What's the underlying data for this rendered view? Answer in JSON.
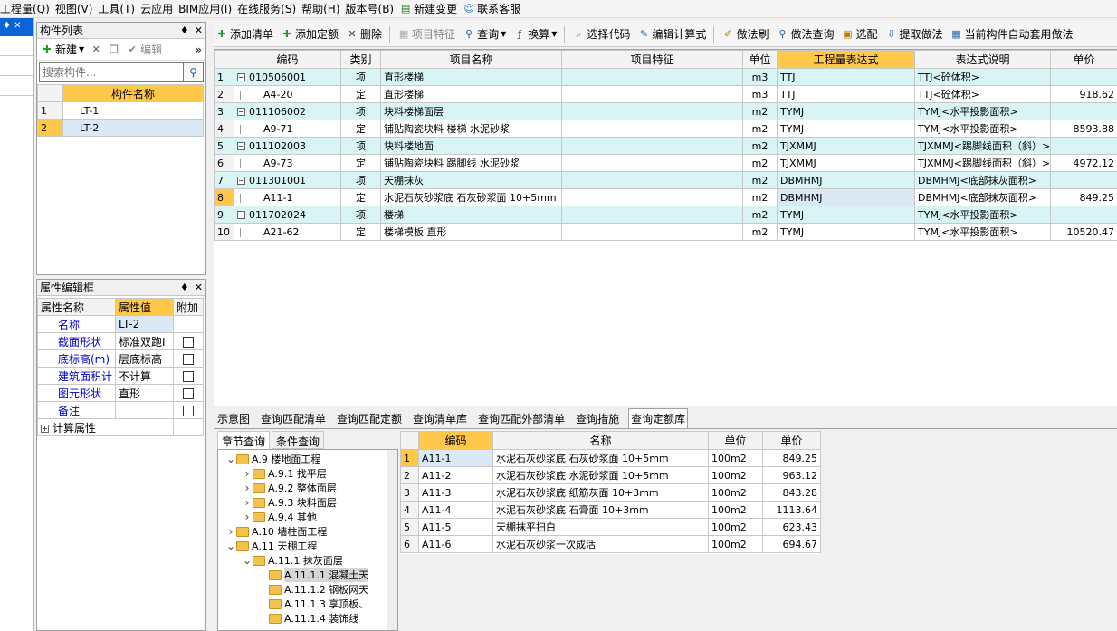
{
  "menu": [
    {
      "label": "工程量(Q)",
      "icon": ""
    },
    {
      "label": "视图(V)",
      "icon": ""
    },
    {
      "label": "工具(T)",
      "icon": ""
    },
    {
      "label": "云应用",
      "icon": ""
    },
    {
      "label": "BIM应用(I)",
      "icon": ""
    },
    {
      "label": "在线服务(S)",
      "icon": ""
    },
    {
      "label": "帮助(H)",
      "icon": ""
    },
    {
      "label": "版本号(B)",
      "icon": ""
    },
    {
      "label": "新建变更",
      "icon": "document-icon"
    },
    {
      "label": "联系客服",
      "icon": "support-icon"
    }
  ],
  "component_list": {
    "title": "构件列表",
    "new_label": "新建",
    "edit_label": "编辑",
    "search_placeholder": "搜索构件...",
    "column": "构件名称",
    "rows": [
      {
        "num": "1",
        "name": "LT-1"
      },
      {
        "num": "2",
        "name": "LT-2"
      }
    ]
  },
  "property_editor": {
    "title": "属性编辑框",
    "columns": [
      "属性名称",
      "属性值",
      "附加"
    ],
    "rows": [
      {
        "name": "名称",
        "value": "LT-2",
        "checkbox": false
      },
      {
        "name": "截面形状",
        "value": "标准双跑I",
        "checkbox": true
      },
      {
        "name": "底标高(m)",
        "value": "层底标高",
        "checkbox": true
      },
      {
        "name": "建筑面积计",
        "value": "不计算",
        "checkbox": true
      },
      {
        "name": "图元形状",
        "value": "直形",
        "checkbox": true
      },
      {
        "name": "备注",
        "value": "",
        "checkbox": true
      }
    ],
    "expand_row": "计算属性"
  },
  "toolbar": [
    {
      "label": "添加清单",
      "icon": "add-list-icon",
      "disabled": false
    },
    {
      "label": "添加定额",
      "icon": "add-quota-icon",
      "disabled": false
    },
    {
      "label": "删除",
      "icon": "delete-icon",
      "disabled": false
    },
    {
      "label": "项目特征",
      "icon": "feature-icon",
      "disabled": true
    },
    {
      "label": "查询",
      "icon": "search-icon",
      "disabled": false
    },
    {
      "label": "换算",
      "icon": "formula-icon",
      "disabled": false
    },
    {
      "label": "选择代码",
      "icon": "code-icon",
      "disabled": false
    },
    {
      "label": "编辑计算式",
      "icon": "edit-formula-icon",
      "disabled": false
    },
    {
      "label": "做法刷",
      "icon": "brush-icon",
      "disabled": false
    },
    {
      "label": "做法查询",
      "icon": "method-query-icon",
      "disabled": false
    },
    {
      "label": "选配",
      "icon": "match-icon",
      "disabled": false
    },
    {
      "label": "提取做法",
      "icon": "extract-icon",
      "disabled": false
    },
    {
      "label": "当前构件自动套用做法",
      "icon": "auto-apply-icon",
      "disabled": false
    }
  ],
  "main_grid": {
    "columns": [
      "编码",
      "类别",
      "项目名称",
      "项目特征",
      "单位",
      "工程量表达式",
      "表达式说明",
      "单价"
    ],
    "rows": [
      {
        "num": "1",
        "code": "010506001",
        "type": "项",
        "name": "直形楼梯",
        "feature": "",
        "unit": "m3",
        "expr": "TTJ",
        "desc": "TTJ<砼体积>",
        "price": "",
        "header": true
      },
      {
        "num": "2",
        "code": "A4-20",
        "type": "定",
        "name": "直形楼梯",
        "feature": "",
        "unit": "m3",
        "expr": "TTJ",
        "desc": "TTJ<砼体积>",
        "price": "918.62",
        "header": false
      },
      {
        "num": "3",
        "code": "011106002",
        "type": "项",
        "name": "块料楼梯面层",
        "feature": "",
        "unit": "m2",
        "expr": "TYMJ",
        "desc": "TYMJ<水平投影面积>",
        "price": "",
        "header": true
      },
      {
        "num": "4",
        "code": "A9-71",
        "type": "定",
        "name": "铺贴陶瓷块料 楼梯 水泥砂浆",
        "feature": "",
        "unit": "m2",
        "expr": "TYMJ",
        "desc": "TYMJ<水平投影面积>",
        "price": "8593.88",
        "header": false
      },
      {
        "num": "5",
        "code": "011102003",
        "type": "项",
        "name": "块料楼地面",
        "feature": "",
        "unit": "m2",
        "expr": "TJXMMJ",
        "desc": "TJXMMJ<踢脚线面积（斜）>",
        "price": "",
        "header": true
      },
      {
        "num": "6",
        "code": "A9-73",
        "type": "定",
        "name": "铺贴陶瓷块料 踢脚线 水泥砂浆",
        "feature": "",
        "unit": "m2",
        "expr": "TJXMMJ",
        "desc": "TJXMMJ<踢脚线面积（斜）>",
        "price": "4972.12",
        "header": false
      },
      {
        "num": "7",
        "code": "011301001",
        "type": "项",
        "name": "天棚抹灰",
        "feature": "",
        "unit": "m2",
        "expr": "DBMHMJ",
        "desc": "DBMHMJ<底部抹灰面积>",
        "price": "",
        "header": true
      },
      {
        "num": "8",
        "code": "A11-1",
        "type": "定",
        "name": "水泥石灰砂浆底 石灰砂浆面 10+5mm",
        "feature": "",
        "unit": "m2",
        "expr": "DBMHMJ",
        "desc": "DBMHMJ<底部抹灰面积>",
        "price": "849.25",
        "header": false,
        "selected": true
      },
      {
        "num": "9",
        "code": "011702024",
        "type": "项",
        "name": "楼梯",
        "feature": "",
        "unit": "m2",
        "expr": "TYMJ",
        "desc": "TYMJ<水平投影面积>",
        "price": "",
        "header": true
      },
      {
        "num": "10",
        "code": "A21-62",
        "type": "定",
        "name": "楼梯模板 直形",
        "feature": "",
        "unit": "m2",
        "expr": "TYMJ",
        "desc": "TYMJ<水平投影面积>",
        "price": "10520.47",
        "header": false
      }
    ]
  },
  "bottom_tabs": [
    {
      "label": "示意图",
      "active": false
    },
    {
      "label": "查询匹配清单",
      "active": false
    },
    {
      "label": "查询匹配定额",
      "active": false
    },
    {
      "label": "查询清单库",
      "active": false
    },
    {
      "label": "查询匹配外部清单",
      "active": false
    },
    {
      "label": "查询措施",
      "active": false
    },
    {
      "label": "查询定额库",
      "active": true
    }
  ],
  "sub_tabs": [
    {
      "label": "章节查询",
      "active": true
    },
    {
      "label": "条件查询",
      "active": false
    }
  ],
  "tree": [
    {
      "label": "A.9 楼地面工程",
      "level": 0,
      "expanded": true,
      "selected": false
    },
    {
      "label": "A.9.1 找平层",
      "level": 1,
      "expanded": false,
      "selected": false
    },
    {
      "label": "A.9.2 整体面层",
      "level": 1,
      "expanded": false,
      "selected": false
    },
    {
      "label": "A.9.3 块料面层",
      "level": 1,
      "expanded": false,
      "selected": false
    },
    {
      "label": "A.9.4 其他",
      "level": 1,
      "expanded": false,
      "selected": false
    },
    {
      "label": "A.10 墙柱面工程",
      "level": 0,
      "expanded": false,
      "selected": false
    },
    {
      "label": "A.11 天棚工程",
      "level": 0,
      "expanded": true,
      "selected": false
    },
    {
      "label": "A.11.1 抹灰面层",
      "level": 1,
      "expanded": true,
      "selected": false
    },
    {
      "label": "A.11.1.1 混凝土天",
      "level": 2,
      "expanded": null,
      "selected": true
    },
    {
      "label": "A.11.1.2 钢板网天",
      "level": 2,
      "expanded": null,
      "selected": false
    },
    {
      "label": "A.11.1.3 享顶板、",
      "level": 2,
      "expanded": null,
      "selected": false
    },
    {
      "label": "A.11.1.4 装饰线",
      "level": 2,
      "expanded": null,
      "selected": false
    }
  ],
  "quota_grid": {
    "columns": [
      "编码",
      "名称",
      "单位",
      "单价"
    ],
    "rows": [
      {
        "num": "1",
        "code": "A11-1",
        "name": "水泥石灰砂浆底 石灰砂浆面 10+5mm",
        "unit": "100m2",
        "price": "849.25",
        "selected": true
      },
      {
        "num": "2",
        "code": "A11-2",
        "name": "水泥石灰砂浆底 水泥砂浆面 10+5mm",
        "unit": "100m2",
        "price": "963.12",
        "selected": false
      },
      {
        "num": "3",
        "code": "A11-3",
        "name": "水泥石灰砂浆底 纸筋灰面 10+3mm",
        "unit": "100m2",
        "price": "843.28",
        "selected": false
      },
      {
        "num": "4",
        "code": "A11-4",
        "name": "水泥石灰砂浆底 石膏面 10+3mm",
        "unit": "100m2",
        "price": "1113.64",
        "selected": false
      },
      {
        "num": "5",
        "code": "A11-5",
        "name": "天棚抹平扫白",
        "unit": "100m2",
        "price": "623.43",
        "selected": false
      },
      {
        "num": "6",
        "code": "A11-6",
        "name": "水泥石灰砂浆一次成活",
        "unit": "100m2",
        "price": "694.67",
        "selected": false
      }
    ]
  },
  "colors": {
    "header_row": "#d9f4f4",
    "highlight": "#ffc84b",
    "selection": "#dbe9f7",
    "property_name": "#0000c8"
  }
}
